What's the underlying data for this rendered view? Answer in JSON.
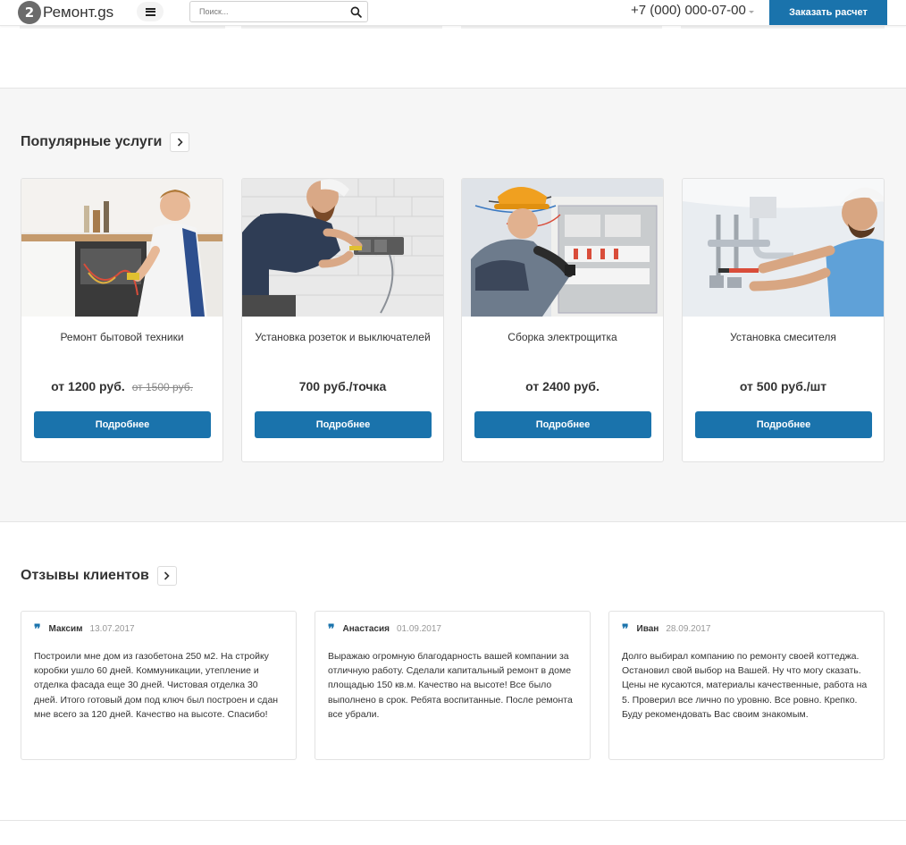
{
  "header": {
    "logo_mark": "2",
    "logo_text": "Ремонт.gs",
    "search_placeholder": "Поиск...",
    "phone": "+7 (000) 000-07-00",
    "order_button": "Заказать расчет"
  },
  "services": {
    "title": "Популярные услуги",
    "items": [
      {
        "title": "Ремонт бытовой техники",
        "price": "от 1200 руб.",
        "old_price": "от 1500 руб.",
        "button": "Подробнее",
        "image": "kitchen-appliance-repair"
      },
      {
        "title": "Установка розеток и выключателей",
        "price": "700 руб./точка",
        "old_price": "",
        "button": "Подробнее",
        "image": "socket-install"
      },
      {
        "title": "Сборка электрощитка",
        "price": "от 2400 руб.",
        "old_price": "",
        "button": "Подробнее",
        "image": "electrical-panel"
      },
      {
        "title": "Установка смесителя",
        "price": "от 500 руб./шт",
        "old_price": "",
        "button": "Подробнее",
        "image": "faucet-install"
      }
    ]
  },
  "reviews": {
    "title": "Отзывы клиентов",
    "items": [
      {
        "name": "Максим",
        "date": "13.07.2017",
        "text": "Построили мне дом из газобетона 250 м2. На стройку коробки ушло 60 дней. Коммуникации, утепление и отделка фасада еще 30 дней. Чистовая отделка 30 дней. Итого готовый дом под ключ был построен и сдан мне всего за 120 дней. Качество на высоте. Спасибо!"
      },
      {
        "name": "Анастасия",
        "date": "01.09.2017",
        "text": "Выражаю огромную благодарность вашей компании за отличную работу. Сделали капитальный ремонт в доме площадью 150 кв.м. Качество на высоте! Все было выполнено в срок. Ребята воспитанные. После ремонта все убрали."
      },
      {
        "name": "Иван",
        "date": "28.09.2017",
        "text": "Долго выбирал компанию по ремонту своей коттеджа. Остановил свой выбор на Вашей. Ну что могу сказать. Цены не кусаются, материалы качественные, работа на 5. Проверил все лично по уровню. Все ровно. Крепко. Буду рекомендовать Вас своим знакомым."
      }
    ]
  },
  "colors": {
    "accent": "#1a73ac",
    "section_bg": "#f6f6f6"
  }
}
